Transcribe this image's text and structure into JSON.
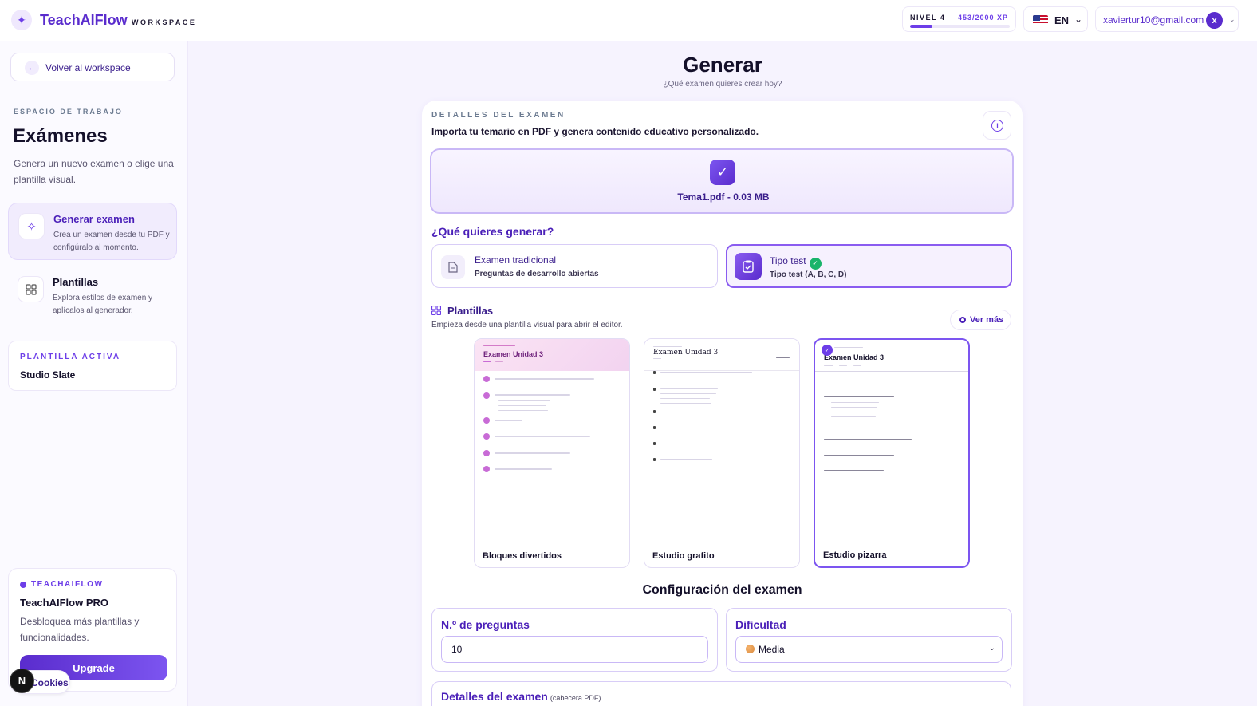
{
  "topbar": {
    "brand": "TeachAIFlow",
    "brand_sub": "WORKSPACE",
    "level_label": "NIVEL 4",
    "xp_text": "453/2000 XP",
    "xp_progress": 0.2265,
    "language": "EN",
    "user_email": "xaviertur10@gmail.com",
    "avatar_initial": "x"
  },
  "sidebar": {
    "back_label": "Volver al workspace",
    "space_label": "ESPACIO DE TRABAJO",
    "space_title": "Exámenes",
    "space_desc": "Genera un nuevo examen o elige una plantilla visual.",
    "items": [
      {
        "title": "Generar examen",
        "desc": "Crea un examen desde tu PDF y configúralo al momento.",
        "icon": "sparkle-icon",
        "active": true
      },
      {
        "title": "Plantillas",
        "desc": "Explora estilos de examen y aplícalos al generador.",
        "icon": "grid-icon",
        "active": false
      }
    ],
    "active_template_label": "PLANTILLA ACTIVA",
    "active_template_value": "Studio Slate",
    "pro": {
      "eyebrow": "TEACHAIFLOW",
      "title": "TeachAIFlow PRO",
      "desc": "Desbloquea más plantillas y funcionalidades.",
      "button": "Upgrade"
    },
    "cookies_label": "Cookies",
    "badge_letter": "N"
  },
  "main": {
    "title": "Generar",
    "subtitle": "¿Qué examen quieres crear hoy?",
    "card": {
      "eyebrow": "DETALLES DEL EXAMEN",
      "intro": "Importa tu temario en PDF y genera contenido educativo personalizado.",
      "uploaded_file": "Tema1.pdf - 0.03 MB",
      "question": "¿Qué quieres generar?",
      "options": [
        {
          "title": "Examen tradicional",
          "desc": "Preguntas de desarrollo abiertas",
          "selected": false
        },
        {
          "title": "Tipo test",
          "desc": "Tipo test (A, B, C, D)",
          "selected": true
        }
      ],
      "templates_title": "Plantillas",
      "templates_sub": "Empieza desde una plantilla visual para abrir el editor.",
      "see_more": "Ver más",
      "templates": [
        {
          "name": "Bloques divertidos",
          "preview_title": "Examen Unidad 3",
          "selected": false
        },
        {
          "name": "Estudio grafito",
          "preview_title": "Examen Unidad 3",
          "selected": false
        },
        {
          "name": "Estudio pizarra",
          "preview_title": "Examen Unidad 3",
          "selected": true
        }
      ],
      "config_title": "Configuración del examen",
      "questions_label": "N.º de preguntas",
      "questions_value": "10",
      "difficulty_label": "Dificultad",
      "difficulty_value": "Media",
      "details_label": "Detalles del examen",
      "details_hint": "(cabecera PDF)"
    }
  },
  "colors": {
    "accent": "#6d3ee8",
    "accent_dark": "#4a1fb8",
    "success": "#19b46a",
    "background": "#f6f3fe"
  }
}
